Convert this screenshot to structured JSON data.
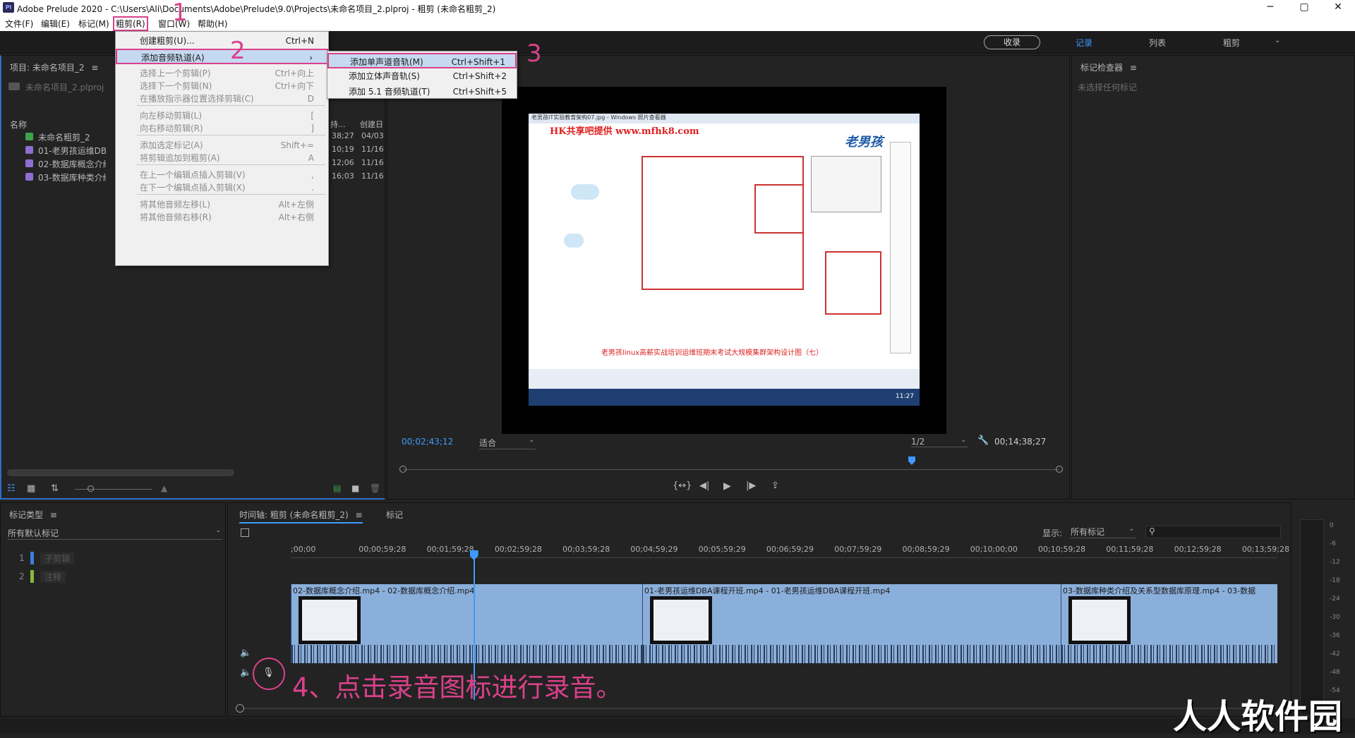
{
  "window": {
    "app_icon": "Pl",
    "title": "Adobe Prelude 2020 - C:\\Users\\Ali\\Documents\\Adobe\\Prelude\\9.0\\Projects\\未命名项目_2.plproj - 粗剪 (未命名粗剪_2)",
    "minimize": "─",
    "maximize": "▢",
    "close": "✕"
  },
  "menubar": [
    "文件(F)",
    "编辑(E)",
    "标记(M)",
    "粗剪(R)",
    "窗口(W)",
    "帮助(H)"
  ],
  "workspace": {
    "ingest_button": "收录",
    "tabs": [
      "记录",
      "列表",
      "粗剪"
    ],
    "active_tab": "记录"
  },
  "rough_cut_menu": {
    "items": [
      {
        "label": "创建粗剪(U)...",
        "shortcut": "Ctrl+N",
        "enabled": true
      },
      {
        "label": "添加音频轨道(A)",
        "shortcut": "›",
        "enabled": true,
        "selected": true
      },
      {
        "label": "选择上一个剪辑(P)",
        "shortcut": "Ctrl+向上",
        "enabled": false
      },
      {
        "label": "选择下一个剪辑(N)",
        "shortcut": "Ctrl+向下",
        "enabled": false
      },
      {
        "label": "在播放指示器位置选择剪辑(C)",
        "shortcut": "D",
        "enabled": false
      },
      {
        "label": "向左移动剪辑(L)",
        "shortcut": "[",
        "enabled": false
      },
      {
        "label": "向右移动剪辑(R)",
        "shortcut": "]",
        "enabled": false
      },
      {
        "label": "添加选定标记(A)",
        "shortcut": "Shift+=",
        "enabled": false
      },
      {
        "label": "将剪辑追加到粗剪(A)",
        "shortcut": "A",
        "enabled": false
      },
      {
        "label": "在上一个编辑点插入剪辑(V)",
        "shortcut": ",",
        "enabled": false
      },
      {
        "label": "在下一个编辑点插入剪辑(X)",
        "shortcut": ".",
        "enabled": false
      },
      {
        "label": "将其他音频左移(L)",
        "shortcut": "Alt+左侧",
        "enabled": false
      },
      {
        "label": "将其他音频右移(R)",
        "shortcut": "Alt+右侧",
        "enabled": false
      }
    ]
  },
  "audio_track_submenu": {
    "items": [
      {
        "label": "添加单声道音轨(M)",
        "shortcut": "Ctrl+Shift+1",
        "selected": true
      },
      {
        "label": "添加立体声音轨(S)",
        "shortcut": "Ctrl+Shift+2"
      },
      {
        "label": "添加 5.1 音频轨道(T)",
        "shortcut": "Ctrl+Shift+5"
      }
    ]
  },
  "annotations": {
    "step1": "1",
    "step2": "2",
    "step3": "3",
    "step4": "4、点击录音图标进行录音。",
    "watermark": "人人软件园"
  },
  "project_panel": {
    "title": "项目: 未命名项目_2",
    "project_file": "未命名项目_2.plproj",
    "columns": {
      "name": "名称",
      "duration": "持...",
      "created": "创建日"
    },
    "rows": [
      {
        "name": "未命名粗剪_2",
        "duration": "38;27",
        "created": "04/03",
        "color": "#3fa34d"
      },
      {
        "name": "01-老男孩运维DBA",
        "duration": "10;19",
        "created": "11/16",
        "color": "#8e6fd1"
      },
      {
        "name": "02-数据库概念介绍",
        "duration": "12;06",
        "created": "11/16",
        "color": "#8e6fd1"
      },
      {
        "name": "03-数据库种类介绍",
        "duration": "16;03",
        "created": "11/16",
        "color": "#8e6fd1"
      }
    ]
  },
  "monitor": {
    "current_timecode": "00;02;43;12",
    "fit": "适合",
    "resolution": "1/2",
    "duration_timecode": "00;14;38;27",
    "playhead_fraction": 0.186,
    "video_text": {
      "window_title": "老男孩IT实验教育架构07.jpg - Windows 照片查看器",
      "banner": "HK共享吧提供 www.mfhk8.com",
      "logo": "老男孩",
      "footer": "老男孩linux高薪实战培训运维班期末考试大规模集群架构设计图（七）",
      "clock": "11:27"
    }
  },
  "marker_inspector": {
    "title": "标记检查器",
    "empty_text": "未选择任何标记"
  },
  "marker_types": {
    "title": "标记类型",
    "filter": "所有默认标记",
    "items": [
      {
        "num": "1",
        "label": "子剪辑",
        "color": "#3d7fd9"
      },
      {
        "num": "2",
        "label": "注释",
        "color": "#8bb83a"
      }
    ]
  },
  "timeline": {
    "tab_title": "时间轴: 粗剪 (未命名粗剪_2)",
    "other_tab": "标记",
    "show_label": "显示:",
    "show_value": "所有标记",
    "ruler": [
      ";00;00",
      "00;00;59;28",
      "00;01;59;28",
      "00;02;59;28",
      "00;03;59;28",
      "00;04;59;29",
      "00;05;59;29",
      "00;06;59;29",
      "00;07;59;29",
      "00;08;59;29",
      "00;10;00;00",
      "00;10;59;28",
      "00;11;59;28",
      "00;12;59;28",
      "00;13;59;28"
    ],
    "clips": [
      {
        "title": "02-数据库概念介绍.mp4 - 02-数据库概念介绍.mp4"
      },
      {
        "title": "01-老男孩运维DBA课程开班.mp4 - 01-老男孩运维DBA课程开班.mp4"
      },
      {
        "title": "03-数据库种类介绍及关系型数据库原理.mp4 - 03-数据"
      }
    ],
    "meter_scale": [
      "0",
      "-6",
      "-12",
      "-18",
      "-24",
      "-30",
      "-36",
      "-42",
      "-48",
      "-54"
    ]
  }
}
